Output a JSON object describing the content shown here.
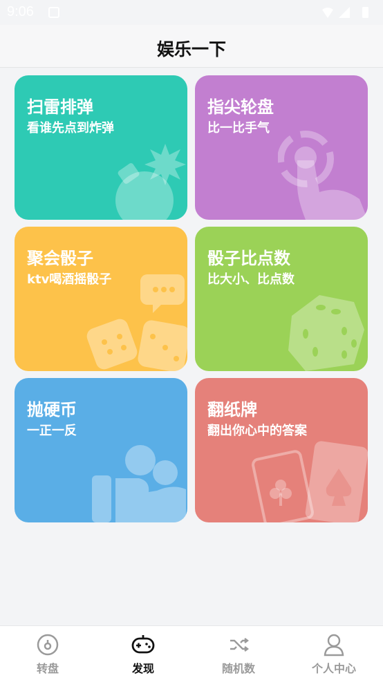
{
  "status": {
    "time": "9:06"
  },
  "header": {
    "title": "娱乐一下"
  },
  "cards": [
    {
      "title": "扫雷排弹",
      "subtitle": "看谁先点到炸弹",
      "color": "#2ecab4",
      "icon": "bomb-icon"
    },
    {
      "title": "指尖轮盘",
      "subtitle": "比一比手气",
      "color": "#c27fd0",
      "icon": "finger-tap-icon"
    },
    {
      "title": "聚会骰子",
      "subtitle": "ktv喝酒摇骰子",
      "color": "#fdc24a",
      "icon": "dice-chat-icon"
    },
    {
      "title": "骰子比点数",
      "subtitle": "比大小、比点数",
      "color": "#9bd257",
      "icon": "dice-icon"
    },
    {
      "title": "抛硬币",
      "subtitle": "一正一反",
      "color": "#5aaee6",
      "icon": "coin-hand-icon"
    },
    {
      "title": "翻纸牌",
      "subtitle": "翻出你心中的答案",
      "color": "#e5817a",
      "icon": "playing-cards-icon"
    }
  ],
  "tabbar": {
    "items": [
      {
        "label": "转盘",
        "icon": "turntable-icon",
        "active": false
      },
      {
        "label": "发现",
        "icon": "gamepad-icon",
        "active": true
      },
      {
        "label": "随机数",
        "icon": "shuffle-icon",
        "active": false
      },
      {
        "label": "个人中心",
        "icon": "person-icon",
        "active": false
      }
    ]
  }
}
